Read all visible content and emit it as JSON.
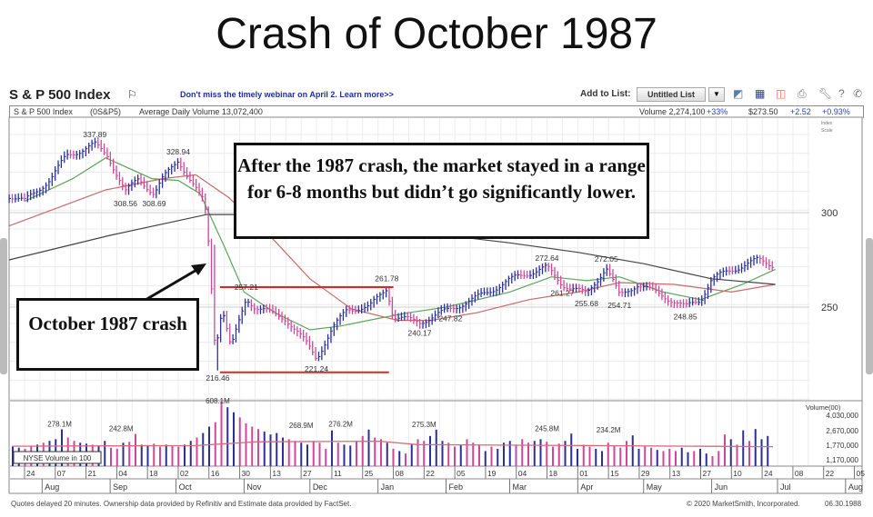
{
  "slide_title": "Crash of October 1987",
  "header": {
    "symbol_title": "S & P 500 Index",
    "promo_link": "Don't miss the timely webinar on April 2. Learn more>>",
    "add_to_list_label": "Add to List:",
    "list_value": "Untitled List",
    "tools": [
      "chart-icon",
      "layout-icon",
      "overlay-icon",
      "print-icon",
      "wrench-icon",
      "help-icon",
      "phone-icon"
    ]
  },
  "infobar": {
    "name": "S & P 500 Index",
    "code": "(0S&P5)",
    "avg_volume": "Average Daily Volume 13,072,400",
    "volume": "Volume 2,274,100",
    "volume_change": "+33%",
    "price": "$273.50",
    "change": "+2.52",
    "change_pct": "+0.93%"
  },
  "annotations": {
    "main": "After the 1987 crash, the market stayed in a range for 6-8 months but didn’t go significantly lower.",
    "crash": "October 1987 crash"
  },
  "footer": {
    "left": "Quotes delayed 20 minutes. Ownership data provided by Refinitiv and Estimate data provided by FactSet.",
    "right": "© 2020 MarketSmith, Incorporated.",
    "date": "06.30.1988"
  },
  "colors": {
    "up": "#2b2f9a",
    "down": "#d0479a",
    "ma_green": "#5aa55a",
    "ma_red": "#c86a6a",
    "ma_black": "#444444",
    "range_line": "#e0261f",
    "vol_avg": "#d86a7a"
  },
  "chart_data": {
    "type": "ohlc-bar",
    "price_axis": {
      "label": "Index Scale",
      "ticks": [
        300,
        250
      ],
      "range": [
        210,
        345
      ]
    },
    "volume_axis": {
      "label": "Volume(00)",
      "scale": "log",
      "ticks": [
        "4,030,000",
        "2,670,000",
        "1,770,000",
        "1,170,000"
      ],
      "tick_values": [
        4030000,
        2670000,
        1770000,
        1170000
      ]
    },
    "volume_legend": "NYSE Volume in 100",
    "grid": true,
    "x_day_ticks": [
      {
        "date": "1987-07-24",
        "label": "24"
      },
      {
        "date": "1987-08-07",
        "label": "07"
      },
      {
        "date": "1987-08-21",
        "label": "21"
      },
      {
        "date": "1987-09-04",
        "label": "04"
      },
      {
        "date": "1987-09-18",
        "label": "18"
      },
      {
        "date": "1987-10-02",
        "label": "02"
      },
      {
        "date": "1987-10-16",
        "label": "16"
      },
      {
        "date": "1987-10-30",
        "label": "30"
      },
      {
        "date": "1987-11-13",
        "label": "13"
      },
      {
        "date": "1987-11-27",
        "label": "27"
      },
      {
        "date": "1987-12-11",
        "label": "11"
      },
      {
        "date": "1987-12-25",
        "label": "25"
      },
      {
        "date": "1988-01-08",
        "label": "08"
      },
      {
        "date": "1988-01-22",
        "label": "22"
      },
      {
        "date": "1988-02-05",
        "label": "05"
      },
      {
        "date": "1988-02-19",
        "label": "19"
      },
      {
        "date": "1988-03-04",
        "label": "04"
      },
      {
        "date": "1988-03-18",
        "label": "18"
      },
      {
        "date": "1988-04-01",
        "label": "01"
      },
      {
        "date": "1988-04-15",
        "label": "15"
      },
      {
        "date": "1988-04-29",
        "label": "29"
      },
      {
        "date": "1988-05-13",
        "label": "13"
      },
      {
        "date": "1988-05-27",
        "label": "27"
      },
      {
        "date": "1988-06-10",
        "label": "10"
      },
      {
        "date": "1988-06-24",
        "label": "24"
      },
      {
        "date": "1988-07-08",
        "label": "08"
      },
      {
        "date": "1988-07-22",
        "label": "22"
      },
      {
        "date": "1988-08-05",
        "label": "05"
      }
    ],
    "x_month_ticks": [
      {
        "date": "1987-08-01",
        "label": "Aug"
      },
      {
        "date": "1987-09-01",
        "label": "Sep"
      },
      {
        "date": "1987-10-01",
        "label": "Oct"
      },
      {
        "date": "1987-11-01",
        "label": "Nov"
      },
      {
        "date": "1987-12-01",
        "label": "Dec"
      },
      {
        "date": "1988-01-01",
        "label": "Jan"
      },
      {
        "date": "1988-02-01",
        "label": "Feb"
      },
      {
        "date": "1988-03-01",
        "label": "Mar"
      },
      {
        "date": "1988-04-01",
        "label": "Apr"
      },
      {
        "date": "1988-05-01",
        "label": "May"
      },
      {
        "date": "1988-06-01",
        "label": "Jun"
      },
      {
        "date": "1988-07-01",
        "label": "Jul"
      },
      {
        "date": "1988-08-01",
        "label": "Aug"
      }
    ],
    "price_close": [
      [
        "1987-07-17",
        309
      ],
      [
        "1987-07-24",
        306
      ],
      [
        "1987-08-05",
        318
      ],
      [
        "1987-08-12",
        330
      ],
      [
        "1987-08-25",
        336
      ],
      [
        "1987-08-31",
        330
      ],
      [
        "1987-09-08",
        311
      ],
      [
        "1987-09-14",
        318
      ],
      [
        "1987-09-21",
        310
      ],
      [
        "1987-09-25",
        318
      ],
      [
        "1987-10-02",
        328
      ],
      [
        "1987-10-07",
        318
      ],
      [
        "1987-10-14",
        305
      ],
      [
        "1987-10-16",
        282
      ],
      [
        "1987-10-19",
        225
      ],
      [
        "1987-10-20",
        236
      ],
      [
        "1987-10-22",
        250
      ],
      [
        "1987-10-26",
        228
      ],
      [
        "1987-11-02",
        255
      ],
      [
        "1987-11-06",
        250
      ],
      [
        "1987-11-13",
        247
      ],
      [
        "1987-11-20",
        244
      ],
      [
        "1987-11-30",
        230
      ],
      [
        "1987-12-04",
        223
      ],
      [
        "1987-12-11",
        238
      ],
      [
        "1987-12-18",
        249
      ],
      [
        "1987-12-28",
        250
      ],
      [
        "1988-01-05",
        260
      ],
      [
        "1988-01-08",
        245
      ],
      [
        "1988-01-20",
        242
      ],
      [
        "1988-02-03",
        249
      ],
      [
        "1988-02-15",
        255
      ],
      [
        "1988-03-04",
        266
      ],
      [
        "1988-03-18",
        271
      ],
      [
        "1988-03-25",
        262
      ],
      [
        "1988-04-05",
        257
      ],
      [
        "1988-04-14",
        271
      ],
      [
        "1988-04-20",
        256
      ],
      [
        "1988-04-28",
        262
      ],
      [
        "1988-05-10",
        256
      ],
      [
        "1988-05-20",
        250
      ],
      [
        "1988-05-27",
        254
      ],
      [
        "1988-06-01",
        265
      ],
      [
        "1988-06-15",
        272
      ],
      [
        "1988-06-22",
        275
      ],
      [
        "1988-06-30",
        272
      ]
    ],
    "price_labels": [
      {
        "date": "1987-08-25",
        "value": "337.89",
        "pos": "above"
      },
      {
        "date": "1987-09-08",
        "value": "308.56",
        "pos": "below"
      },
      {
        "date": "1987-09-21",
        "value": "308.69",
        "pos": "below"
      },
      {
        "date": "1987-10-02",
        "value": "328.94",
        "pos": "above"
      },
      {
        "date": "1987-10-20",
        "value": "216.46",
        "pos": "below"
      },
      {
        "date": "1987-11-02",
        "value": "257.21",
        "pos": "above"
      },
      {
        "date": "1987-12-04",
        "value": "221.24",
        "pos": "below"
      },
      {
        "date": "1988-01-05",
        "value": "261.78",
        "pos": "above"
      },
      {
        "date": "1988-01-20",
        "value": "240.17",
        "pos": "below"
      },
      {
        "date": "1988-02-03",
        "value": "247.82",
        "pos": "below"
      },
      {
        "date": "1988-03-18",
        "value": "272.64",
        "pos": "above"
      },
      {
        "date": "1988-03-25",
        "value": "261.27",
        "pos": "below"
      },
      {
        "date": "1988-04-05",
        "value": "255.68",
        "pos": "below"
      },
      {
        "date": "1988-04-14",
        "value": "272.05",
        "pos": "above"
      },
      {
        "date": "1988-04-20",
        "value": "254.71",
        "pos": "below"
      },
      {
        "date": "1988-05-20",
        "value": "248.85",
        "pos": "below"
      }
    ],
    "moving_averages": [
      {
        "color": "#5aa55a",
        "points": [
          [
            "1987-07-24",
            306
          ],
          [
            "1987-08-15",
            318
          ],
          [
            "1987-08-30",
            329
          ],
          [
            "1987-09-20",
            318
          ],
          [
            "1987-10-02",
            317
          ],
          [
            "1987-10-12",
            310
          ],
          [
            "1987-10-23",
            282
          ],
          [
            "1987-11-01",
            258
          ],
          [
            "1987-11-15",
            247
          ],
          [
            "1987-12-01",
            238
          ],
          [
            "1987-12-15",
            240
          ],
          [
            "1988-01-01",
            244
          ],
          [
            "1988-01-15",
            247
          ],
          [
            "1988-02-01",
            250
          ],
          [
            "1988-03-01",
            258
          ],
          [
            "1988-03-20",
            266
          ],
          [
            "1988-04-05",
            264
          ],
          [
            "1988-04-20",
            266
          ],
          [
            "1988-05-10",
            258
          ],
          [
            "1988-05-27",
            254
          ],
          [
            "1988-06-15",
            262
          ],
          [
            "1988-06-30",
            270
          ]
        ]
      },
      {
        "color": "#c86a6a",
        "points": [
          [
            "1987-07-17",
            293
          ],
          [
            "1987-08-30",
            312
          ],
          [
            "1987-09-25",
            318
          ],
          [
            "1987-10-10",
            320
          ],
          [
            "1987-10-25",
            308
          ],
          [
            "1987-11-15",
            285
          ],
          [
            "1987-12-01",
            265
          ],
          [
            "1987-12-20",
            249
          ],
          [
            "1988-01-10",
            243
          ],
          [
            "1988-01-25",
            243
          ],
          [
            "1988-02-15",
            247
          ],
          [
            "1988-03-10",
            254
          ],
          [
            "1988-04-01",
            258
          ],
          [
            "1988-04-20",
            263
          ],
          [
            "1988-05-15",
            262
          ],
          [
            "1988-06-10",
            258
          ],
          [
            "1988-06-30",
            262
          ]
        ]
      },
      {
        "color": "#444444",
        "points": [
          [
            "1987-07-17",
            275
          ],
          [
            "1987-09-01",
            288
          ],
          [
            "1987-10-15",
            299
          ],
          [
            "1987-11-01",
            299
          ],
          [
            "1987-12-01",
            295
          ],
          [
            "1988-01-01",
            292
          ],
          [
            "1988-02-01",
            288
          ],
          [
            "1988-03-01",
            284
          ],
          [
            "1988-04-01",
            279
          ],
          [
            "1988-05-01",
            273
          ],
          [
            "1988-06-01",
            265
          ],
          [
            "1988-06-30",
            262
          ]
        ]
      }
    ],
    "range_lines": [
      {
        "value": 260.6,
        "from": "1987-10-21",
        "to": "1988-01-08"
      },
      {
        "value": 215.5,
        "from": "1987-10-21",
        "to": "1988-01-06"
      }
    ],
    "volume_millions": [
      170,
      165,
      160,
      175,
      180,
      190,
      200,
      210,
      278,
      220,
      200,
      190,
      185,
      180,
      175,
      200,
      165,
      160,
      190,
      195,
      243,
      180,
      175,
      185,
      170,
      180,
      175,
      170,
      180,
      200,
      220,
      250,
      300,
      340,
      608,
      520,
      450,
      390,
      330,
      300,
      280,
      260,
      240,
      250,
      220,
      210,
      200,
      190,
      180,
      200,
      190,
      160,
      269,
      190,
      180,
      175,
      200,
      230,
      276,
      220,
      210,
      190,
      160,
      150,
      140,
      180,
      210,
      200,
      230,
      275,
      200,
      190,
      170,
      180,
      210,
      190,
      180,
      150,
      170,
      160,
      190,
      200,
      180,
      210,
      190,
      200,
      210,
      195,
      170,
      185,
      200,
      246,
      160,
      180,
      170,
      160,
      150,
      190,
      175,
      165,
      200,
      234,
      160,
      170,
      165,
      155,
      150,
      160,
      150,
      165,
      145,
      150,
      160,
      140,
      130,
      150,
      240,
      210,
      180,
      270,
      200,
      280,
      210,
      230
    ],
    "volume_updown": "uudduduuudduuduuddudduuddudduuduudduudddduuuudduuddduduudduddudududduuudduddduduuuddduuddduuudduudddduudduddduuduudddudud",
    "volume_avg_millions": [
      [
        0,
        172
      ],
      [
        30,
        175
      ],
      [
        40,
        195
      ],
      [
        60,
        198
      ],
      [
        66,
        180
      ],
      [
        124,
        170
      ]
    ],
    "volume_labels": [
      {
        "date": "1987-08-09",
        "value": "278.1M"
      },
      {
        "date": "1987-09-06",
        "value": "242.8M"
      },
      {
        "date": "1987-10-20",
        "value": "608.1M"
      },
      {
        "date": "1987-11-27",
        "value": "268.9M"
      },
      {
        "date": "1987-12-15",
        "value": "276.2M"
      },
      {
        "date": "1988-01-22",
        "value": "275.3M"
      },
      {
        "date": "1988-03-18",
        "value": "245.8M"
      },
      {
        "date": "1988-04-15",
        "value": "234.2M"
      }
    ]
  }
}
